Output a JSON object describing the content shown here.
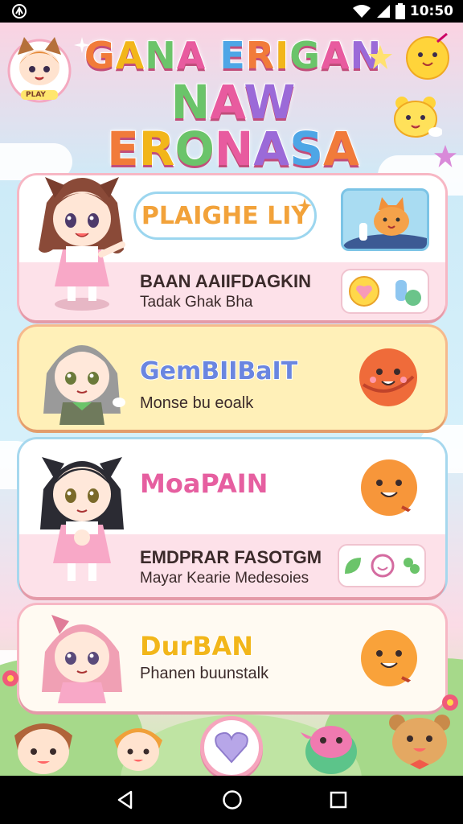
{
  "status_bar": {
    "time": "10:50"
  },
  "header": {
    "title_line1": "GANA ERIGAN",
    "title_line2": "NAW ERONASA",
    "logo_text": "PLAY"
  },
  "cards": [
    {
      "title": "PLAIGHE LIY",
      "heading": "BAAN AAIIFDAGKIN",
      "subtitle": "Tadak Ghak Bha"
    },
    {
      "title": "GemBIIBaIT",
      "subtitle": "Monse bu eoalk"
    },
    {
      "title": "MoaPAIN",
      "heading": "EMDPRAR FASOTGM",
      "subtitle": "Mayar Kearie Medesoies"
    },
    {
      "title": "DurBAN",
      "subtitle": "Phanen buunstalk"
    }
  ],
  "colors": {
    "pink": "#f6a5bd",
    "blue": "#9cd6ef",
    "yellow": "#fff1b5",
    "orange": "#f39a4d"
  },
  "icons": [
    "back-icon",
    "home-icon",
    "recents-icon",
    "heart-icon",
    "wifi-icon",
    "battery-icon"
  ]
}
